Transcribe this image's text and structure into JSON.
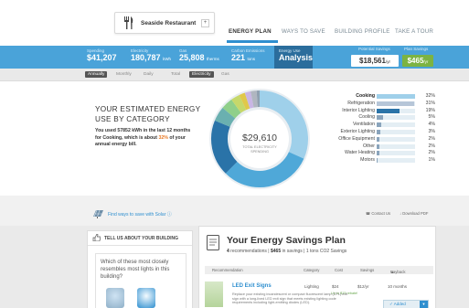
{
  "header": {
    "restaurant_name": "Seaside Restaurant",
    "dropdown_glyph": "+",
    "nav": [
      {
        "label": "ENERGY PLAN",
        "active": true
      },
      {
        "label": "WAYS TO SAVE",
        "active": false
      },
      {
        "label": "BUILDING PROFILE",
        "active": false
      },
      {
        "label": "TAKE A TOUR",
        "active": false
      }
    ],
    "accent_color": "#2f8fcf"
  },
  "metrics": {
    "spending": {
      "label": "Spending",
      "value": "$41,207"
    },
    "electricity": {
      "label": "Electricity",
      "value": "180,787",
      "unit": "kWh"
    },
    "gas": {
      "label": "Gas",
      "value": "25,808",
      "unit": "therms"
    },
    "carbon": {
      "label": "Carbon Emissions",
      "value": "221",
      "unit": "tons"
    },
    "view": {
      "label": "Energy Use",
      "value": "Analysis"
    },
    "potential_savings": {
      "label": "Potential Savings",
      "value": "$18,561",
      "unit": "/yr"
    },
    "plan_savings": {
      "label": "Plan Savings",
      "value": "$465",
      "unit": "/yr"
    }
  },
  "subtabs": [
    {
      "label": "Annually",
      "active": true
    },
    {
      "label": "Monthly",
      "active": false
    },
    {
      "label": "Daily",
      "active": false
    },
    {
      "label": "Total",
      "active": false
    },
    {
      "label": "Electricity",
      "active": true
    },
    {
      "label": "Gas",
      "active": false
    }
  ],
  "category": {
    "title_line1": "YOUR ESTIMATED ENERGY",
    "title_line2": "USE BY CATEGORY",
    "desc_pre": "You used 57852 kWh in the last 12 months for Cooking, which is about",
    "desc_highlight": "32%",
    "desc_post": "of your annual energy bill.",
    "donut_total": "$29,610",
    "donut_label_1": "TOTAL ELECTRICITY",
    "donut_label_2": "SPENDING",
    "items": [
      {
        "label": "Cooking",
        "pct": "32%",
        "value": 32,
        "color": "#9fd0ea",
        "bold": true
      },
      {
        "label": "Refrigeration",
        "pct": "31%",
        "value": 31,
        "color": "#4fa8d8",
        "bold": false
      },
      {
        "label": "Interior Lighting",
        "pct": "19%",
        "value": 19,
        "color": "#2a73a8",
        "bold": false
      },
      {
        "label": "Cooling",
        "pct": "5%",
        "value": 5,
        "color": "#6ab0b0",
        "bold": false
      },
      {
        "label": "Ventilation",
        "pct": "4%",
        "value": 4,
        "color": "#8fcf8a",
        "bold": false
      },
      {
        "label": "Exterior Lighting",
        "pct": "3%",
        "value": 3,
        "color": "#c6d86a",
        "bold": false
      },
      {
        "label": "Office Equipment",
        "pct": "2%",
        "value": 2,
        "color": "#e0c84a",
        "bold": false
      },
      {
        "label": "Other",
        "pct": "2%",
        "value": 2,
        "color": "#c9b6e4",
        "bold": false
      },
      {
        "label": "Water Heating",
        "pct": "2%",
        "value": 2,
        "color": "#b0b6c0",
        "bold": false
      },
      {
        "label": "Motors",
        "pct": "1%",
        "value": 1,
        "color": "#8fa0b0",
        "bold": false
      }
    ]
  },
  "solar": {
    "link": "Find ways to save with Solar",
    "contact": "Contact Us",
    "download": "Download PDF"
  },
  "building": {
    "heading": "TELL US ABOUT YOUR BUILDING",
    "question": "Which of these most closely resembles most lights in this building?"
  },
  "plan": {
    "title": "Your Energy Savings Plan",
    "count": "4",
    "count_text": "recommendations",
    "savings": "$465",
    "savings_text": "in savings",
    "co2_text": "1 tons CO2 Savings",
    "columns": [
      "Recommendation",
      "Category",
      "Cost",
      "Savings",
      "Payback"
    ],
    "row": {
      "title": "LED Exit Signs",
      "category": "Lighting",
      "cost": "$24",
      "savings": "$12/yr",
      "payback": "10 months",
      "rebate": "Up to $15 rebate!",
      "desc": "Replace your existing incandescent or compact fluorescent lamp (CFL) exit sign with a long-lived LED exit sign that meets existing lighting code requirements including light-emitting diodes (LED).",
      "button": "Added"
    }
  }
}
